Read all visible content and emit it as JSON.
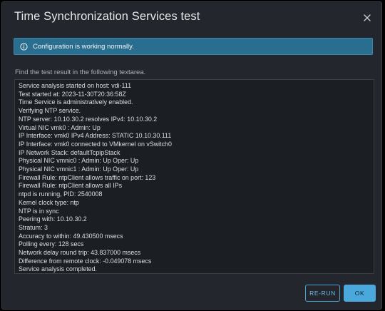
{
  "dialog": {
    "title": "Time Synchronization Services test",
    "alert_text": "Configuration is working normally.",
    "hint": "Find the test result in the following textarea.",
    "result_lines": [
      "Service analysis started on host: vdi-111",
      "Test started at: 2023-11-30T20:36:58Z",
      "Time Service is administratively enabled.",
      "Verifying NTP service.",
      "NTP server: 10.10.30.2 resolves IPv4: 10.10.30.2",
      "Virtual NIC vmk0 : Admin: Up",
      "IP Interface: vmk0 IPv4 Address: STATIC 10.10.30.111",
      "IP Interface: vmk0 connected to VMkernel on vSwitch0",
      "IP Network Stack: defaultTcpipStack",
      "Physical NIC vmnic0 : Admin: Up Oper: Up",
      "Physical NIC vmnic1 : Admin: Up Oper: Up",
      "Firewall Rule: ntpClient allows traffic on port: 123",
      "Firewall Rule: ntpClient allows all IPs",
      "ntpd is running, PID: 2540008",
      "Kernel clock type: ntp",
      "NTP is in sync",
      "Peering with: 10.10.30.2",
      "Stratum: 3",
      "Accuracy to within: 49.430500 msecs",
      "Polling every: 128 secs",
      "Network delay round trip: 43.837000 msecs",
      "Difference from remote clock: -0.049078 msecs",
      "Service analysis completed."
    ],
    "rerun_label": "RE-RUN",
    "ok_label": "OK"
  },
  "colors": {
    "dialog_bg": "#23272d",
    "alert_bg": "#2a6e8f",
    "primary": "#4ba8dc"
  },
  "icons": {
    "close": "close-icon",
    "alert": "info-icon"
  }
}
